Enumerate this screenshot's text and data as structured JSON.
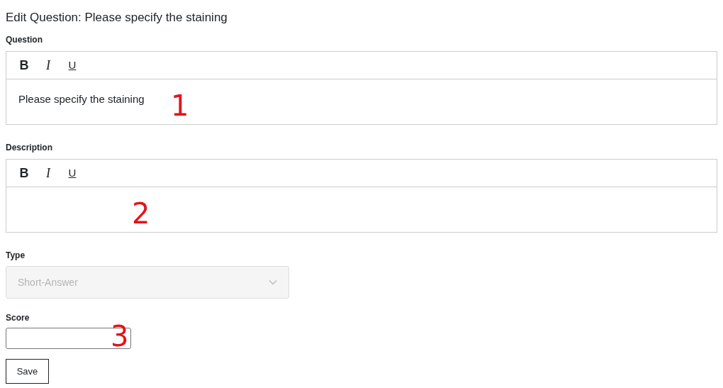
{
  "title": "Edit Question: Please specify the staining",
  "question": {
    "label": "Question",
    "toolbar": [
      "B",
      "I",
      "U"
    ],
    "value": "Please specify the staining",
    "annotation": "1"
  },
  "description": {
    "label": "Description",
    "toolbar": [
      "B",
      "I",
      "U"
    ],
    "annotation": "2"
  },
  "type": {
    "label": "Type",
    "value": "Short-Answer",
    "disabled": true
  },
  "score": {
    "label": "Score",
    "annotation": "3"
  },
  "save_button": "Save"
}
